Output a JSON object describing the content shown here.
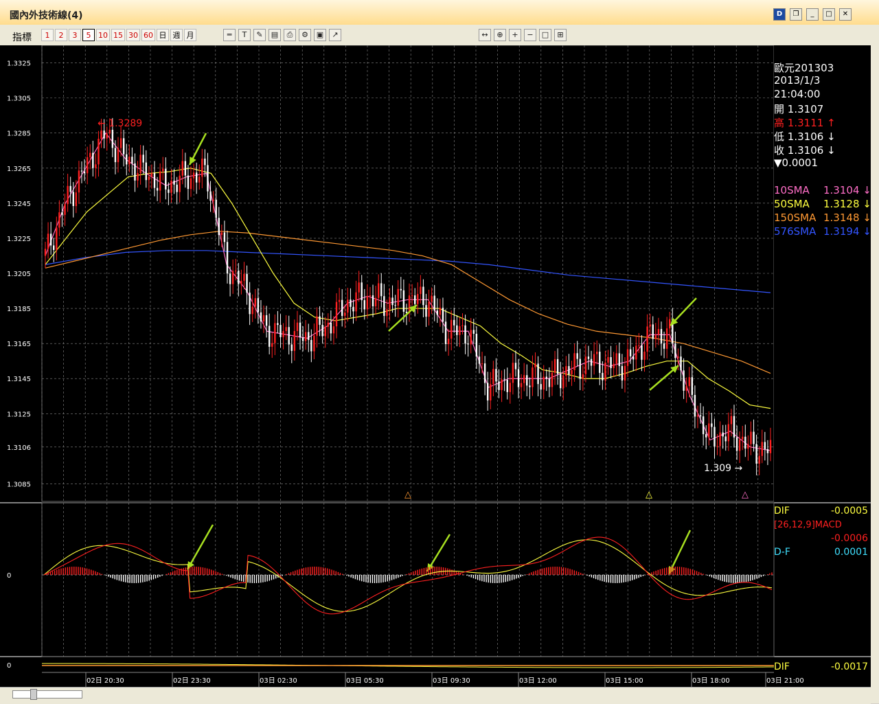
{
  "window": {
    "title": "國內外技術線(4)",
    "d_label": "D"
  },
  "toolbar": {
    "indicator_label": "指標",
    "periods": [
      "1",
      "2",
      "3",
      "5",
      "10",
      "15",
      "30",
      "60",
      "日",
      "週",
      "月"
    ],
    "selected_period": "5"
  },
  "info": {
    "symbol": "歐元201303",
    "date": "2013/1/3",
    "time": "21:04:00",
    "open_label": "開",
    "open": "1.3107",
    "high_label": "高",
    "high": "1.3111",
    "low_label": "低",
    "low": "1.3106",
    "close_label": "收",
    "close": "1.3106",
    "change": "▼0.0001",
    "sma": [
      {
        "name": "10SMA",
        "value": "1.3104",
        "color": "#ff6ec7"
      },
      {
        "name": "50SMA",
        "value": "1.3128",
        "color": "#ffff40"
      },
      {
        "name": "150SMA",
        "value": "1.3148",
        "color": "#ff9933"
      },
      {
        "name": "576SMA",
        "value": "1.3194",
        "color": "#3355ff"
      }
    ]
  },
  "macd_info": {
    "dif_label": "DIF",
    "dif": "-0.0005",
    "macd_label": "[26,12,9]MACD",
    "macd": "-0.0006",
    "df_label": "D-F",
    "df": "0.0001"
  },
  "bottom_info": {
    "dif_label": "DIF",
    "dif": "-0.0017"
  },
  "colors": {
    "up": "#ff2020",
    "down": "#ffffff",
    "grid": "#888888",
    "sma10": "#ff6ec7",
    "sma50": "#ffff40",
    "sma150": "#ff9933",
    "sma576": "#3355ff",
    "arrow": "#a8e020"
  },
  "chart_data": {
    "type": "line",
    "title": "",
    "instrument": "歐元201303",
    "interval": "5 分",
    "y_ticks": [
      "1.3325",
      "1.3305",
      "1.3285",
      "1.3265",
      "1.3245",
      "1.3225",
      "1.3205",
      "1.3185",
      "1.3165",
      "1.3145",
      "1.3125",
      "1.3106",
      "1.3085"
    ],
    "ylim": [
      1.3075,
      1.3335
    ],
    "x_ticks": [
      "02日 20:30",
      "02日 23:30",
      "03日 02:30",
      "03日 05:30",
      "03日 09:30",
      "03日 12:00",
      "03日 15:00",
      "03日 18:00",
      "03日 21:00"
    ],
    "annotations": {
      "high_mark": "1.3289",
      "low_mark": "1.309"
    },
    "series": [
      {
        "name": "10SMA",
        "values": [
          1.3215,
          1.3245,
          1.3265,
          1.3285,
          1.327,
          1.3262,
          1.3255,
          1.326,
          1.3262,
          1.321,
          1.3195,
          1.3172,
          1.317,
          1.3168,
          1.3175,
          1.3188,
          1.3192,
          1.3188,
          1.319,
          1.319,
          1.3172,
          1.3172,
          1.314,
          1.3145,
          1.3145,
          1.3145,
          1.315,
          1.3155,
          1.3152,
          1.3155,
          1.317,
          1.317,
          1.3135,
          1.311,
          1.3115,
          1.3106,
          1.3104
        ]
      },
      {
        "name": "50SMA",
        "values": [
          1.321,
          1.3225,
          1.324,
          1.325,
          1.326,
          1.3262,
          1.3263,
          1.3265,
          1.3262,
          1.3245,
          1.3225,
          1.3205,
          1.3188,
          1.318,
          1.3178,
          1.318,
          1.3182,
          1.3185,
          1.3185,
          1.3185,
          1.318,
          1.3175,
          1.3165,
          1.3158,
          1.315,
          1.3148,
          1.3145,
          1.3145,
          1.3148,
          1.3152,
          1.3155,
          1.3155,
          1.3145,
          1.3138,
          1.313,
          1.3128
        ]
      },
      {
        "name": "150SMA",
        "values": [
          1.3208,
          1.3212,
          1.3216,
          1.322,
          1.3224,
          1.3227,
          1.3229,
          1.3228,
          1.3226,
          1.3224,
          1.3222,
          1.322,
          1.3218,
          1.3215,
          1.321,
          1.32,
          1.319,
          1.3182,
          1.3176,
          1.3172,
          1.317,
          1.3168,
          1.3165,
          1.316,
          1.3155,
          1.3148
        ]
      },
      {
        "name": "576SMA",
        "values": [
          1.321,
          1.3214,
          1.3217,
          1.3218,
          1.3218,
          1.3217,
          1.3216,
          1.3215,
          1.3214,
          1.3213,
          1.3212,
          1.321,
          1.3207,
          1.3204,
          1.3202,
          1.32,
          1.3198,
          1.3196,
          1.3194
        ]
      }
    ]
  }
}
